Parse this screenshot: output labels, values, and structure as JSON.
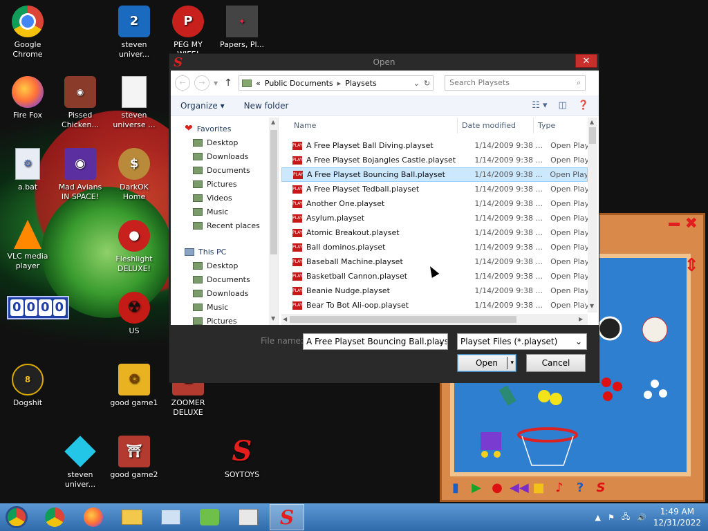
{
  "desktop": {
    "icons": [
      {
        "label": "Google Chrome",
        "icon": "chrome-icon"
      },
      {
        "label": "steven univer...",
        "icon": "steven-universe-icon"
      },
      {
        "label": "PEG MY WIFE!",
        "icon": "peg-icon"
      },
      {
        "label": "Papers, Pl...",
        "icon": "papers-please-icon"
      },
      {
        "label": "Fire Fox",
        "icon": "firefox-icon"
      },
      {
        "label": "Pissed Chicken...",
        "icon": "angry-birds-seasons-icon"
      },
      {
        "label": "steven universe ...",
        "icon": "file-icon"
      },
      {
        "label": "a.bat",
        "icon": "bat-file-icon"
      },
      {
        "label": "Mad Avians IN SPACE!",
        "icon": "angry-birds-space-icon"
      },
      {
        "label": "DarkOK Home",
        "icon": "money-bag-icon"
      },
      {
        "label": "VLC media player",
        "icon": "vlc-icon"
      },
      {
        "label": "Fleshlight DELUXE!",
        "icon": "red-creature-icon"
      },
      {
        "label": "US",
        "icon": "radiation-icon"
      },
      {
        "label": "Dogshit",
        "icon": "ball-icon"
      },
      {
        "label": "good game1",
        "icon": "mahjong-icon"
      },
      {
        "label": "ZOOMER DELUXE",
        "icon": "zoomer-icon"
      },
      {
        "label": "steven univer...",
        "icon": "diamond-icon"
      },
      {
        "label": "good game2",
        "icon": "mahjong-gate-icon"
      },
      {
        "label": "SOYTOYS",
        "icon": "soytoys-icon"
      }
    ],
    "counter": [
      "0",
      "0",
      "0",
      "0"
    ]
  },
  "dialog": {
    "title": "Open",
    "close": "✕",
    "address": {
      "prefix": "«",
      "parts": [
        "Public Documents",
        "Playsets"
      ]
    },
    "search_placeholder": "Search Playsets",
    "toolbar": {
      "organize": "Organize ▾",
      "new_folder": "New folder"
    },
    "tree": {
      "favorites": "Favorites",
      "favorites_items": [
        "Desktop",
        "Downloads",
        "Documents",
        "Pictures",
        "Videos",
        "Music",
        "Recent places"
      ],
      "this_pc": "This PC",
      "pc_items": [
        "Desktop",
        "Documents",
        "Downloads",
        "Music",
        "Pictures"
      ]
    },
    "columns": {
      "name": "Name",
      "date": "Date modified",
      "type": "Type"
    },
    "files": [
      {
        "name": "A Free Playset Ball Diving.playset",
        "date": "1/14/2009 9:38 ...",
        "type": "Open Plays"
      },
      {
        "name": "A Free Playset Bojangles Castle.playset",
        "date": "1/14/2009 9:38 ...",
        "type": "Open Plays"
      },
      {
        "name": "A Free Playset Bouncing Ball.playset",
        "date": "1/14/2009 9:38 ...",
        "type": "Open Plays"
      },
      {
        "name": "A Free Playset Tedball.playset",
        "date": "1/14/2009 9:38 ...",
        "type": "Open Plays"
      },
      {
        "name": "Another One.playset",
        "date": "1/14/2009 9:38 ...",
        "type": "Open Plays"
      },
      {
        "name": "Asylum.playset",
        "date": "1/14/2009 9:38 ...",
        "type": "Open Plays"
      },
      {
        "name": "Atomic Breakout.playset",
        "date": "1/14/2009 9:38 ...",
        "type": "Open Plays"
      },
      {
        "name": "Ball dominos.playset",
        "date": "1/14/2009 9:38 ...",
        "type": "Open Plays"
      },
      {
        "name": "Baseball Machine.playset",
        "date": "1/14/2009 9:38 ...",
        "type": "Open Plays"
      },
      {
        "name": "Basketball Cannon.playset",
        "date": "1/14/2009 9:38 ...",
        "type": "Open Plays"
      },
      {
        "name": "Beanie Nudge.playset",
        "date": "1/14/2009 9:38 ...",
        "type": "Open Plays"
      },
      {
        "name": "Bear To Bot Ali-oop.playset",
        "date": "1/14/2009 9:38 ...",
        "type": "Open Plays"
      }
    ],
    "selected_index": 2,
    "file_name_label": "File name:",
    "file_name_value": "A Free Playset Bouncing Ball.plays",
    "file_type_value": "Playset Files (*.playset)",
    "open_label": "Open",
    "cancel_label": "Cancel"
  },
  "taskbar": {
    "time": "1:49 AM",
    "date": "12/31/2022"
  },
  "colors": {
    "selection": "#cce8ff",
    "taskbar": "#3d7bbf",
    "accent_red": "#e51d1d"
  }
}
